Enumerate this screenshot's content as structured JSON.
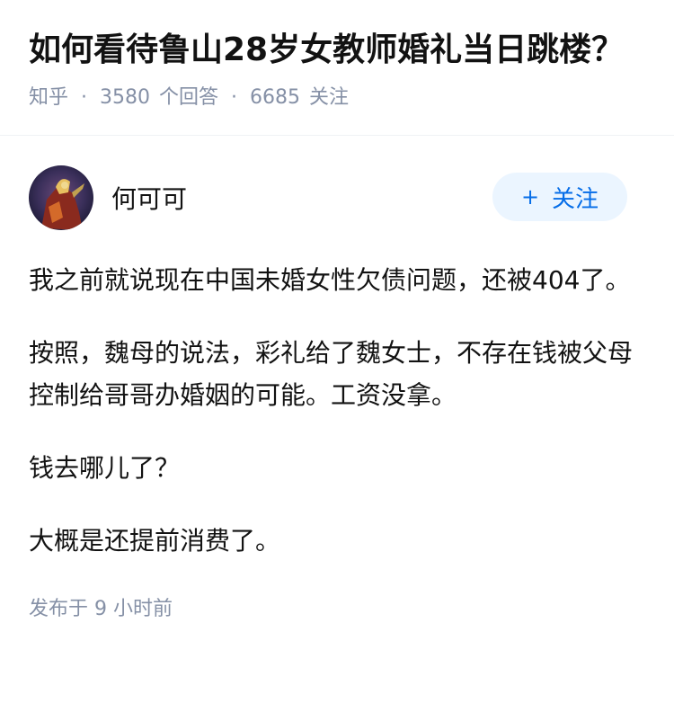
{
  "question": {
    "title": "如何看待鲁山28岁女教师婚礼当日跳楼？",
    "source": "知乎",
    "answer_count": "3580",
    "answer_label": "个回答",
    "follower_count": "6685",
    "follower_label": "关注"
  },
  "answer": {
    "author_name": "何可可",
    "follow_button": "关注",
    "paragraphs": [
      "我之前就说现在中国未婚女性欠债问题，还被404了。",
      "按照，魏母的说法，彩礼给了魏女士，不存在钱被父母控制给哥哥办婚姻的可能。工资没拿。",
      "钱去哪儿了？",
      "大概是还提前消费了。"
    ],
    "published": "发布于 9 小时前"
  },
  "colors": {
    "primary_text": "#121212",
    "secondary_text": "#8590a6",
    "follow_button_bg": "#ebf5ff",
    "follow_button_text": "#056de8"
  }
}
